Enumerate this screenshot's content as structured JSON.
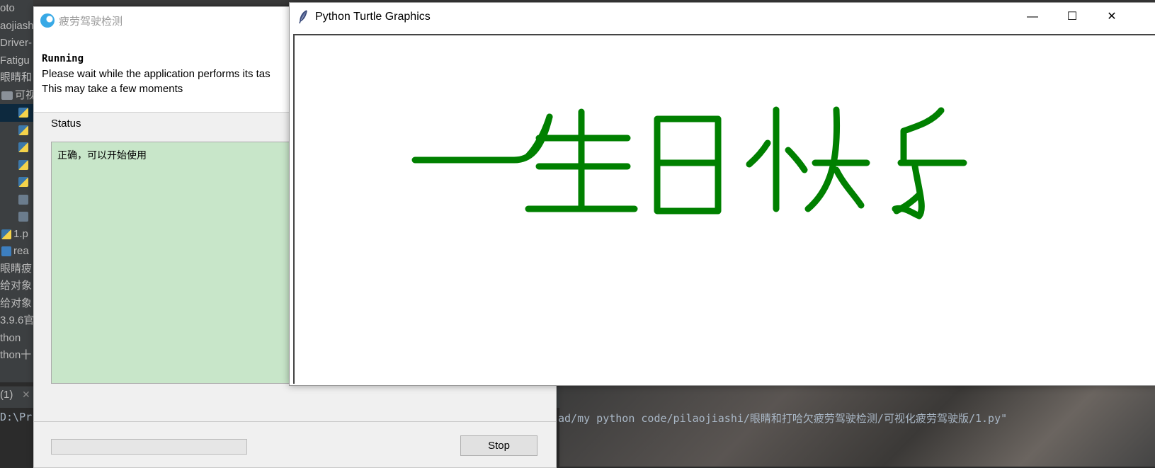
{
  "ide": {
    "tree_items": [
      {
        "label": "oto",
        "icon": "none"
      },
      {
        "label": "aojiash",
        "icon": "none"
      },
      {
        "label": "Driver-",
        "icon": "none"
      },
      {
        "label": "Fatigu",
        "icon": "none"
      },
      {
        "label": "眼睛和",
        "icon": "none"
      },
      {
        "label": "可视",
        "icon": "folder-icon"
      },
      {
        "label": "",
        "icon": "python-file-icon",
        "selected": true
      },
      {
        "label": "",
        "icon": "python-file-icon"
      },
      {
        "label": "",
        "icon": "python-file-icon"
      },
      {
        "label": "",
        "icon": "python-file-icon"
      },
      {
        "label": "",
        "icon": "python-file-icon"
      },
      {
        "label": "",
        "icon": "unknown-file-icon"
      },
      {
        "label": "",
        "icon": "unknown-file-icon"
      },
      {
        "label": "1.p",
        "icon": "python-file-icon"
      },
      {
        "label": "rea",
        "icon": "markdown-file-icon"
      },
      {
        "label": "眼睛疲",
        "icon": "none"
      },
      {
        "label": "给对象",
        "icon": "none"
      },
      {
        "label": "给对象",
        "icon": "none"
      },
      {
        "label": "3.9.6官",
        "icon": "none"
      },
      {
        "label": "thon",
        "icon": "none"
      },
      {
        "label": "thon十",
        "icon": "none"
      }
    ],
    "run_tab_label": "(1)",
    "console_left": "D:\\Pr",
    "console_right": "ad/my python code/pilaojiashi/眼睛和打哈欠疲劳驾驶检测/可视化疲劳驾驶版/1.py\""
  },
  "dialog": {
    "title": "疲劳驾驶检测",
    "heading": "Running",
    "line1": "Please wait while the application performs its tas",
    "line2": "This may take a few moments",
    "status_label": "Status",
    "status_text": "正确，可以开始使用",
    "progress_percent": 0,
    "stop_label": "Stop",
    "status_bg_color": "#c8e6c9"
  },
  "turtle": {
    "title": "Python Turtle Graphics",
    "minimize_label": "—",
    "maximize_label": "☐",
    "close_label": "✕",
    "drawing_text": "一生日快乐",
    "pen_color": "#008000"
  }
}
